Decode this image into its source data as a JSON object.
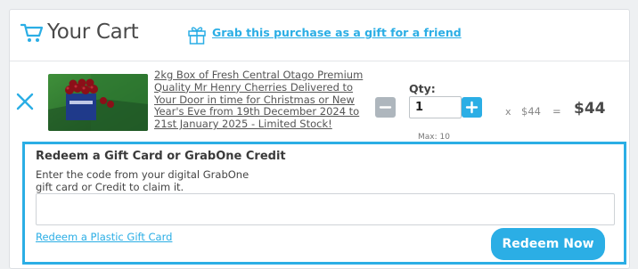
{
  "header": {
    "title": "Your Cart",
    "gift_link": "Grab this purchase as a gift for a friend"
  },
  "cart_item": {
    "name": "2kg Box of Fresh Central Otago Premium Quality Mr Henry Cherries Delivered to Your Door in time for Christmas or New Year's Eve from 19th December 2024 to 21st January 2025 - Limited Stock!",
    "qty_label": "Qty:",
    "quantity": "1",
    "max_label": "Max: 10",
    "times_symbol": "x",
    "unit_price": "$44",
    "equals_symbol": "=",
    "total_price": "$44"
  },
  "redeem": {
    "title": "Redeem a Gift Card or GrabOne Credit",
    "description": "Enter the code from your digital GrabOne gift card or Credit to claim it.",
    "code_value": "",
    "plastic_link": "Redeem a Plastic Gift Card",
    "button_label": "Redeem Now"
  },
  "colors": {
    "accent": "#2baee5",
    "minus_button": "#aeb6bd"
  },
  "icons": {
    "cart": "cart-icon",
    "gift": "gift-icon",
    "remove": "close-icon",
    "minus": "minus-icon",
    "plus": "plus-icon"
  }
}
